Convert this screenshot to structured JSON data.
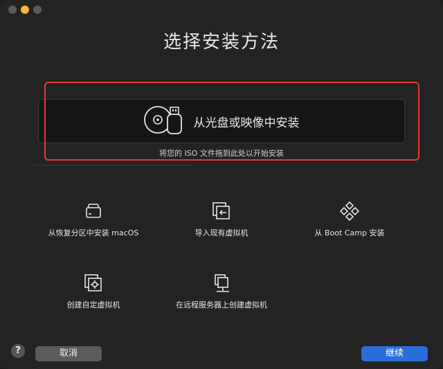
{
  "window": {
    "title": "选择安装方法"
  },
  "drop_area": {
    "label": "从光盘或映像中安装",
    "hint": "将您的 ISO 文件拖到此处以开始安装"
  },
  "options": [
    {
      "label": "从恢复分区中安装 macOS",
      "icon": "disk-drive-icon"
    },
    {
      "label": "导入现有虚拟机",
      "icon": "import-vm-icon"
    },
    {
      "label": "从 Boot Camp 安装",
      "icon": "boot-camp-icon"
    },
    {
      "label": "创建自定虚拟机",
      "icon": "custom-vm-icon"
    },
    {
      "label": "在远程服务器上创建虚拟机",
      "icon": "remote-server-icon"
    }
  ],
  "footer": {
    "help": "?",
    "cancel": "取消",
    "continue": "继续"
  },
  "colors": {
    "highlight": "#e43b35",
    "primary_button": "#2a6ed9",
    "minimize_dot": "#f5b73a"
  }
}
